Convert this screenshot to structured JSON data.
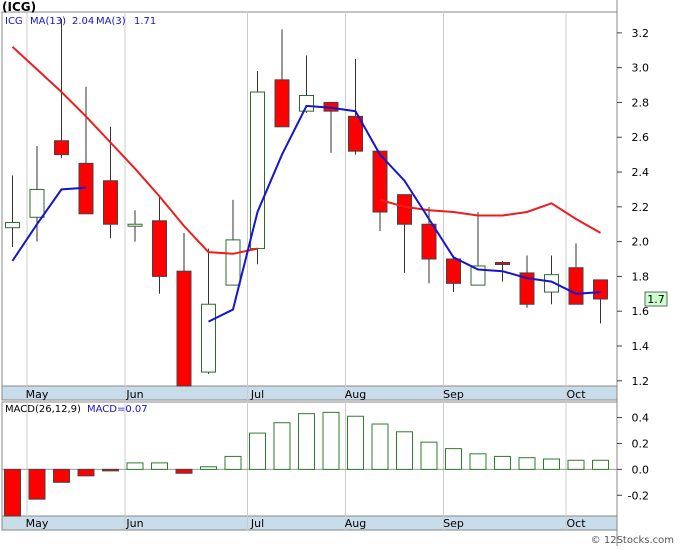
{
  "title": "(ICG)",
  "footer": "© 12Stocks.com",
  "colors": {
    "up": "#ffffff",
    "down": "#ff0000",
    "wick": "#333333",
    "ma13": "#ee1c1c",
    "ma3": "#1515cc",
    "macd_bar": "#2e7d2e",
    "axis_band": "#c9dce9",
    "grid": "#cccccc"
  },
  "chart_data": [
    {
      "type": "candlestick",
      "legend": {
        "symbol": "ICG",
        "ma13_label": "MA(13)",
        "ma13_value": "2.04",
        "ma3_label": "MA(3)",
        "ma3_value": "1.71"
      },
      "last_price_label": "1.7",
      "ylim": [
        1.17,
        3.32
      ],
      "y_ticks": [
        1.2,
        1.4,
        1.6,
        1.8,
        2.0,
        2.2,
        2.4,
        2.6,
        2.8,
        3.0,
        3.2
      ],
      "y_tick_labels": [
        "1.2",
        "1.4",
        "1.6",
        "1.8",
        "2.0",
        "2.2",
        "2.4",
        "2.6",
        "2.8",
        "3.0",
        "3.2"
      ],
      "x_labels": [
        {
          "label": "May",
          "index": 1
        },
        {
          "label": "Jun",
          "index": 5
        },
        {
          "label": "Jul",
          "index": 10
        },
        {
          "label": "Aug",
          "index": 14
        },
        {
          "label": "Sep",
          "index": 18
        },
        {
          "label": "Oct",
          "index": 23
        }
      ],
      "candles": [
        {
          "o": 2.08,
          "h": 2.38,
          "l": 1.97,
          "c": 2.11
        },
        {
          "o": 2.14,
          "h": 2.55,
          "l": 2.0,
          "c": 2.3
        },
        {
          "o": 2.58,
          "h": 3.28,
          "l": 2.48,
          "c": 2.5
        },
        {
          "o": 2.45,
          "h": 2.89,
          "l": 2.16,
          "c": 2.16
        },
        {
          "o": 2.35,
          "h": 2.66,
          "l": 2.02,
          "c": 2.1
        },
        {
          "o": 2.1,
          "h": 2.18,
          "l": 2.0,
          "c": 2.1
        },
        {
          "o": 2.12,
          "h": 2.26,
          "l": 1.7,
          "c": 1.8
        },
        {
          "o": 1.83,
          "h": 2.05,
          "l": 1.17,
          "c": 1.17
        },
        {
          "o": 1.25,
          "h": 1.96,
          "l": 1.24,
          "c": 1.64
        },
        {
          "o": 1.75,
          "h": 2.24,
          "l": 1.75,
          "c": 2.01
        },
        {
          "o": 1.96,
          "h": 2.98,
          "l": 1.87,
          "c": 2.86
        },
        {
          "o": 2.93,
          "h": 3.22,
          "l": 2.66,
          "c": 2.66
        },
        {
          "o": 2.75,
          "h": 3.07,
          "l": 2.74,
          "c": 2.84
        },
        {
          "o": 2.8,
          "h": 2.8,
          "l": 2.51,
          "c": 2.75
        },
        {
          "o": 2.72,
          "h": 3.05,
          "l": 2.5,
          "c": 2.52
        },
        {
          "o": 2.52,
          "h": 2.52,
          "l": 2.06,
          "c": 2.17
        },
        {
          "o": 2.27,
          "h": 2.27,
          "l": 1.82,
          "c": 2.1
        },
        {
          "o": 2.1,
          "h": 2.2,
          "l": 1.76,
          "c": 1.9
        },
        {
          "o": 1.9,
          "h": 1.92,
          "l": 1.71,
          "c": 1.76
        },
        {
          "o": 1.75,
          "h": 2.17,
          "l": 1.75,
          "c": 1.86
        },
        {
          "o": 1.88,
          "h": 1.89,
          "l": 1.77,
          "c": 1.87
        },
        {
          "o": 1.82,
          "h": 1.92,
          "l": 1.62,
          "c": 1.64
        },
        {
          "o": 1.71,
          "h": 1.92,
          "l": 1.64,
          "c": 1.81
        },
        {
          "o": 1.85,
          "h": 1.99,
          "l": 1.64,
          "c": 1.64
        },
        {
          "o": 1.78,
          "h": 1.78,
          "l": 1.53,
          "c": 1.67
        }
      ],
      "series": [
        {
          "name": "MA(13)",
          "values": [
            3.12,
            2.99,
            2.86,
            2.72,
            2.57,
            2.42,
            2.26,
            2.09,
            1.94,
            1.93,
            1.96,
            null,
            null,
            null,
            null,
            2.24,
            2.2,
            2.18,
            2.17,
            2.15,
            2.15,
            2.17,
            2.22,
            2.13,
            2.05
          ]
        },
        {
          "name": "MA(3)",
          "values": [
            1.89,
            2.1,
            2.3,
            2.31,
            null,
            null,
            null,
            null,
            1.54,
            1.61,
            2.17,
            2.5,
            2.78,
            2.77,
            2.75,
            2.5,
            2.35,
            2.13,
            1.91,
            1.84,
            1.83,
            1.79,
            1.77,
            1.7,
            1.71
          ]
        }
      ]
    },
    {
      "type": "bar",
      "legend": {
        "macd_label": "MACD(26,12,9)",
        "macd_value_label": "MACD=0.07"
      },
      "ylim": [
        -0.36,
        0.52
      ],
      "y_ticks": [
        -0.2,
        0.0,
        0.2,
        0.4
      ],
      "y_tick_labels": [
        "-0.2",
        "0.0",
        "0.2",
        "0.4"
      ],
      "values": [
        -0.36,
        -0.23,
        -0.1,
        -0.05,
        -0.01,
        0.05,
        0.05,
        -0.03,
        0.02,
        0.1,
        0.28,
        0.36,
        0.43,
        0.44,
        0.41,
        0.35,
        0.29,
        0.21,
        0.16,
        0.12,
        0.1,
        0.09,
        0.08,
        0.07,
        0.07
      ]
    }
  ]
}
